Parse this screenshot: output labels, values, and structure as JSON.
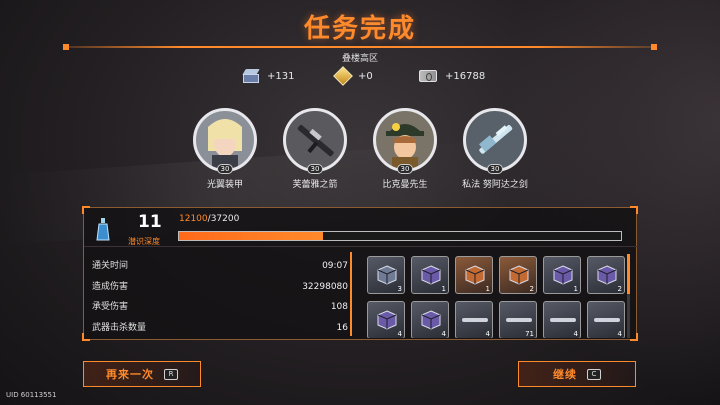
{
  "header": {
    "title": "任务完成",
    "area_name": "叠楼高区"
  },
  "rewards": [
    {
      "icon": "cube-currency-icon",
      "amount": "+131"
    },
    {
      "icon": "gold-gem-icon",
      "amount": "+0"
    },
    {
      "icon": "cash-icon",
      "amount": "+16788"
    }
  ],
  "characters": [
    {
      "name": "光翼装甲",
      "level": "30",
      "icon": "blonde-character-portrait"
    },
    {
      "name": "芙蕾雅之箭",
      "level": "30",
      "icon": "rifle-weapon-portrait"
    },
    {
      "name": "比克曼先生",
      "level": "30",
      "icon": "cap-character-portrait"
    },
    {
      "name": "私法 努阿达之剑",
      "level": "30",
      "icon": "sword-weapon-portrait"
    }
  ],
  "progress": {
    "depth_value": "11",
    "depth_label": "潜识深度",
    "exp_current": "12100",
    "exp_sep": "/",
    "exp_max": "37200",
    "exp_fraction": 0.325
  },
  "stats": [
    {
      "label": "通关时间",
      "value": "09:07"
    },
    {
      "label": "造成伤害",
      "value": "32298080"
    },
    {
      "label": "承受伤害",
      "value": "108"
    },
    {
      "label": "武器击杀数量",
      "value": "16"
    }
  ],
  "loot": [
    {
      "kind": "cube",
      "tint": "gray",
      "count": "3"
    },
    {
      "kind": "cube",
      "tint": "purple",
      "count": "1"
    },
    {
      "kind": "cube",
      "tint": "orange",
      "count": "1"
    },
    {
      "kind": "cube",
      "tint": "orange",
      "count": "2"
    },
    {
      "kind": "cube",
      "tint": "purple",
      "count": "1"
    },
    {
      "kind": "cube",
      "tint": "purple",
      "count": "2"
    },
    {
      "kind": "cube",
      "tint": "purple",
      "count": "4"
    },
    {
      "kind": "cube",
      "tint": "purple",
      "count": "4"
    },
    {
      "kind": "weapon",
      "tint": "gray",
      "count": "4"
    },
    {
      "kind": "weapon",
      "tint": "gray",
      "count": "71"
    },
    {
      "kind": "weapon",
      "tint": "gray",
      "count": "4"
    },
    {
      "kind": "weapon",
      "tint": "gray",
      "count": "4"
    }
  ],
  "buttons": {
    "retry_label": "再来一次",
    "retry_key": "R",
    "continue_label": "继续",
    "continue_key": "C"
  },
  "footer": {
    "uid": "UID 60113551"
  },
  "colors": {
    "accent": "#ff8a2b",
    "panel_border": "#8c5b32"
  }
}
